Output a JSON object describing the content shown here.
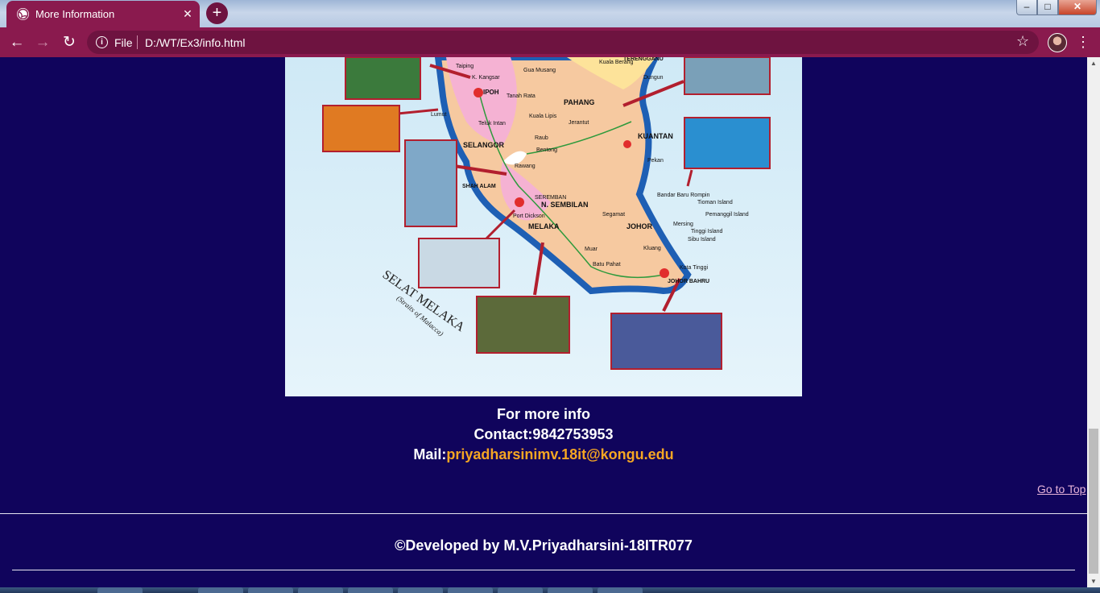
{
  "browser": {
    "tab_title": "More Information",
    "tab_close": "✕",
    "new_tab": "+",
    "url_scheme": "File",
    "url": "D:/WT/Ex3/info.html",
    "back": "←",
    "forward": "→",
    "reload": "↻",
    "star": "☆",
    "menu": "⋮",
    "win_min": "–",
    "win_max": "□",
    "win_close": "✕"
  },
  "map": {
    "regions": [
      "Taiping",
      "K. Kangsar",
      "IPOH",
      "Tanah Rata",
      "Gua Musang",
      "Kuala Berang",
      "TERENGGANU",
      "Dungun",
      "PAHANG",
      "Kuala Lipis",
      "Jerantut",
      "Lumut",
      "Teluk Intan",
      "Raub",
      "SELANGOR",
      "Bentong",
      "Rawang",
      "KUANTAN",
      "Pekan",
      "SHAH ALAM",
      "SEREMBAN",
      "N. SEMBILAN",
      "Bandar Baru Rompin",
      "Tioman Island",
      "Pemanggil Island",
      "Segamat",
      "Mersing",
      "Tinggi Island",
      "Sibu Island",
      "JOHOR",
      "Port Dickson",
      "MELAKA",
      "Kluang",
      "Muar",
      "Batu Pahat",
      "Kota Tinggi",
      "JOHOR BAHRU"
    ],
    "strait_label": "SELAT MELAKA",
    "strait_sub": "(Straits of Malacca)"
  },
  "info": {
    "heading": "For more info",
    "contact": "Contact:9842753953",
    "mail_label": "Mail:",
    "mail": "priyadharsinimv.18it@kongu.edu"
  },
  "go_to_top": "Go to Top",
  "footer": "©Developed by M.V.Priyadharsini-18ITR077"
}
